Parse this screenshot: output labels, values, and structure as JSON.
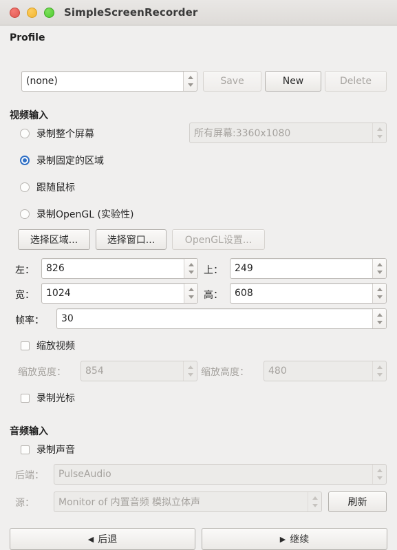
{
  "window": {
    "title": "SimpleScreenRecorder",
    "controls": [
      {
        "name": "close-button",
        "color": "#e05a52"
      },
      {
        "name": "minimize-button",
        "color": "#f2b632"
      },
      {
        "name": "maximize-button",
        "color": "#4fcb2f"
      }
    ]
  },
  "profile": {
    "heading": "Profile",
    "selected": "(none)",
    "save_label": "Save",
    "new_label": "New",
    "delete_label": "Delete"
  },
  "video_input": {
    "heading": "视频输入",
    "options": [
      {
        "label": "录制整个屏幕",
        "checked": false
      },
      {
        "label": "录制固定的区域",
        "checked": true
      },
      {
        "label": "跟随鼠标",
        "checked": false
      },
      {
        "label": "录制OpenGL (实验性)",
        "checked": false
      }
    ],
    "screen_combo": "所有屏幕:3360x1080",
    "select_area_label": "选择区域...",
    "select_window_label": "选择窗口...",
    "opengl_settings_label": "OpenGL设置...",
    "left_label": "左：",
    "left_value": "826",
    "top_label": "上：",
    "top_value": "249",
    "width_label": "宽：",
    "width_value": "1024",
    "height_label": "高：",
    "height_value": "608",
    "framerate_label": "帧率：",
    "framerate_value": "30",
    "scale_video_label": "缩放视频",
    "scaled_width_label": "缩放宽度：",
    "scaled_width_value": "854",
    "scaled_height_label": "缩放高度：",
    "scaled_height_value": "480",
    "record_cursor_label": "录制光标"
  },
  "audio_input": {
    "heading": "音频输入",
    "record_audio_label": "录制声音",
    "backend_label": "后端：",
    "backend_value": "PulseAudio",
    "source_label": "源：",
    "source_value": "Monitor of 内置音频 模拟立体声",
    "refresh_label": "刷新"
  },
  "navigation": {
    "back_label": "后退",
    "back_icon": "◆",
    "continue_label": "继续",
    "continue_icon": "◆"
  },
  "colors": {
    "accent": "#2f6fc4",
    "background": "#f0efee",
    "titlebar": "#e3e0dd"
  }
}
